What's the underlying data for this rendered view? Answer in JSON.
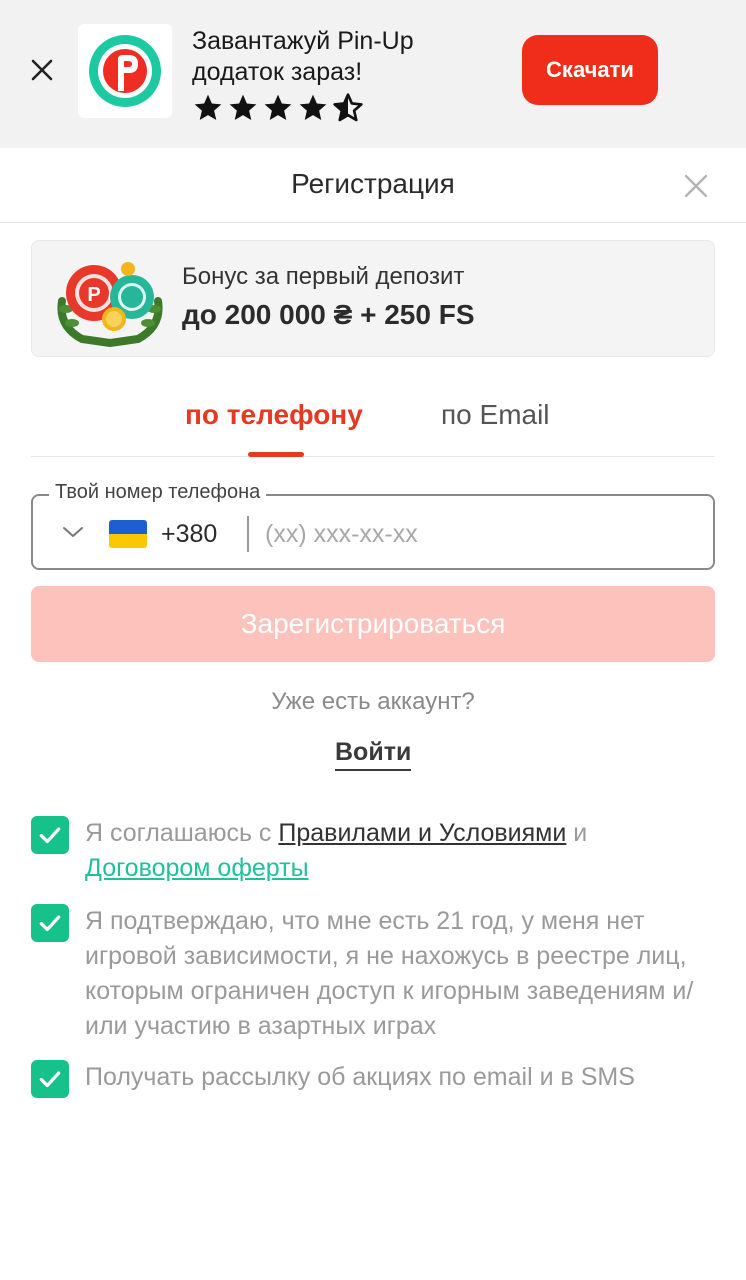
{
  "banner": {
    "title_line1": "Завантажуй Pin-Up",
    "title_line2": "додаток зараз!",
    "rating": 4.5,
    "download_label": "Скачати",
    "accent_color": "#f02d1b"
  },
  "header": {
    "title": "Регистрация"
  },
  "bonus": {
    "line1": "Бонус за первый депозит",
    "line2": "до 200 000 ₴ + 250 FS"
  },
  "tabs": [
    {
      "label": "по телефону",
      "active": true
    },
    {
      "label": "по Email",
      "active": false
    }
  ],
  "phone": {
    "label": "Твой номер телефона",
    "dial_code": "+380",
    "placeholder": "(xx) xxx-xx-xx",
    "country_icon": "ukraine-flag-icon"
  },
  "register_label": "Зарегистрироваться",
  "have_account": "Уже есть аккаунт?",
  "login_label": "Войти",
  "consents": {
    "terms_prefix": "Я соглашаюсь с",
    "terms_link": "Правилами и Условиями",
    "terms_and": "и",
    "offer_link": "Договором оферты",
    "age_text": "Я подтверждаю, что мне есть 21 год, у меня нет игровой зависимости, я не нахожусь в реестре лиц, которым ограничен доступ к игорным заведениям и/или участию в азартных играх",
    "newsletter_text": "Получать рассылку об акциях по email и в SMS"
  }
}
